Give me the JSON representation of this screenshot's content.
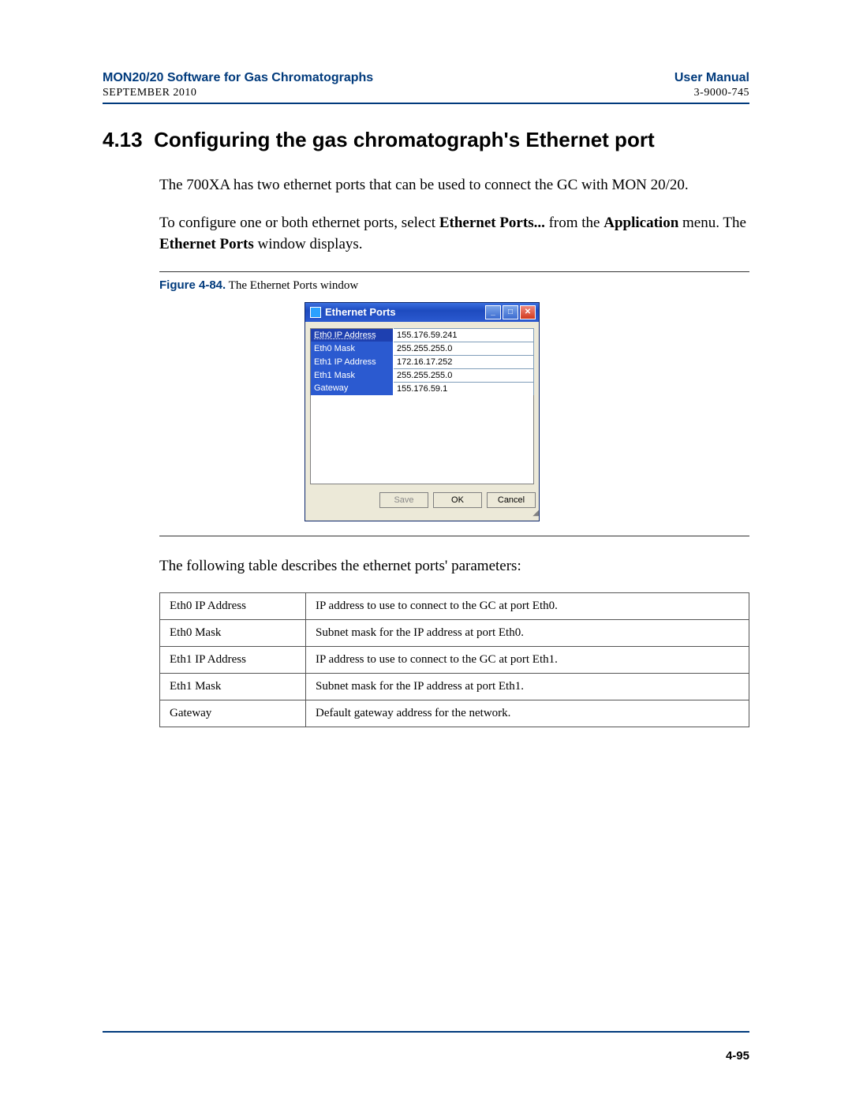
{
  "header": {
    "title_left": "MON20/20 Software for Gas Chromatographs",
    "title_right": "User Manual",
    "date": "SEPTEMBER 2010",
    "doc_number": "3-9000-745"
  },
  "section": {
    "number": "4.13",
    "title": "Configuring the gas chromatograph's Ethernet port"
  },
  "paragraphs": {
    "p1": "The 700XA has two ethernet ports that can be used to connect the GC with MON 20/20.",
    "p2_a": "To configure one or both ethernet ports, select ",
    "p2_b": "Ethernet Ports...",
    "p2_c": " from the ",
    "p2_d": "Application",
    "p2_e": " menu.  The ",
    "p2_f": "Ethernet Ports",
    "p2_g": " window displays."
  },
  "figure": {
    "label": "Figure 4-84.",
    "caption": "  The Ethernet Ports window"
  },
  "window": {
    "title": "Ethernet Ports",
    "buttons": {
      "save": "Save",
      "ok": "OK",
      "cancel": "Cancel"
    },
    "rows": [
      {
        "label": "Eth0 IP Address",
        "value": "155.176.59.241"
      },
      {
        "label": "Eth0 Mask",
        "value": "255.255.255.0"
      },
      {
        "label": "Eth1 IP Address",
        "value": "172.16.17.252"
      },
      {
        "label": "Eth1 Mask",
        "value": "255.255.255.0"
      },
      {
        "label": "Gateway",
        "value": "155.176.59.1"
      }
    ]
  },
  "table_intro": "The following table describes the ethernet ports' parameters:",
  "param_table": [
    {
      "name": "Eth0 IP Address",
      "desc": "IP address to use to connect to the GC at port Eth0."
    },
    {
      "name": "Eth0 Mask",
      "desc": "Subnet mask for the IP address at port Eth0."
    },
    {
      "name": "Eth1 IP Address",
      "desc": "IP address to use to connect to the GC at port Eth1."
    },
    {
      "name": "Eth1 Mask",
      "desc": "Subnet mask for the IP address at port Eth1."
    },
    {
      "name": "Gateway",
      "desc": "Default gateway address for the network."
    }
  ],
  "footer": {
    "page": "4-95"
  }
}
